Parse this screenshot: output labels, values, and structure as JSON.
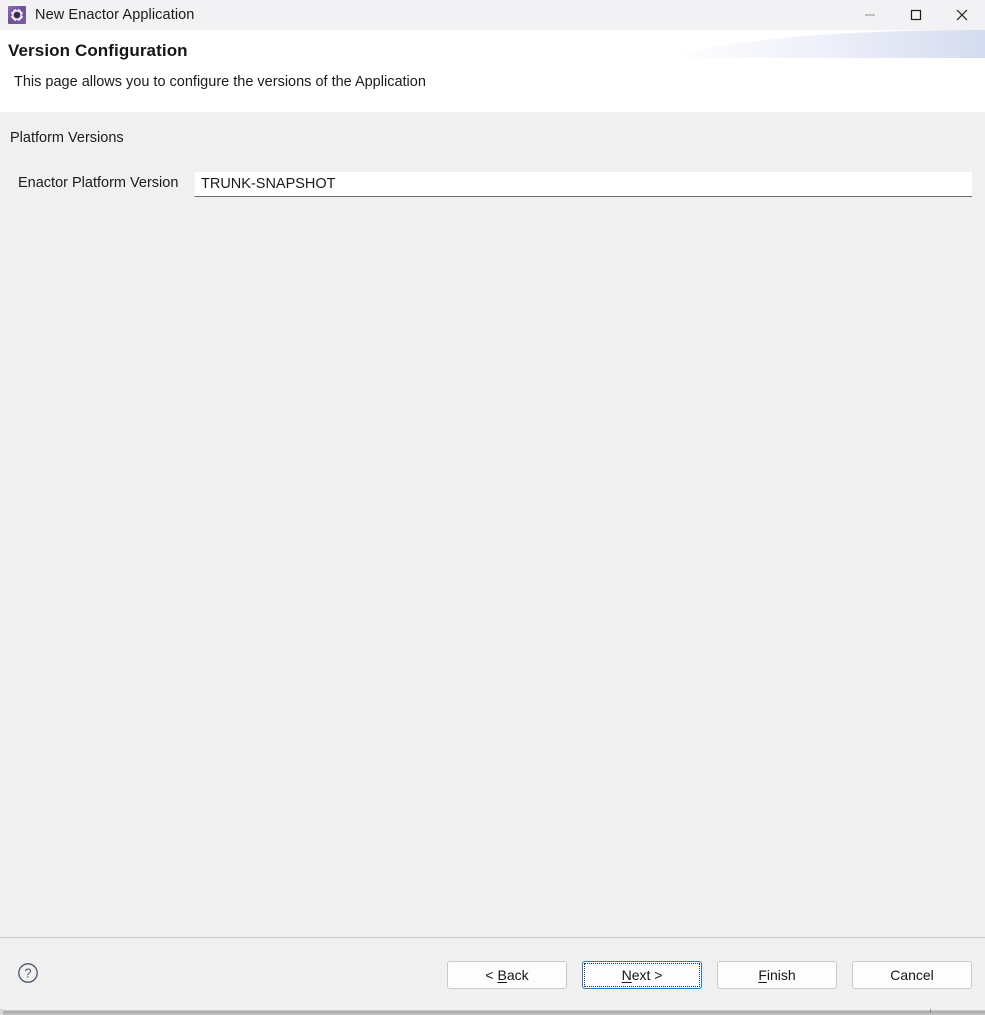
{
  "window": {
    "title": "New Enactor Application",
    "icon": "gear-icon",
    "controls": {
      "minimize": "minimize-icon",
      "maximize": "maximize-icon",
      "close": "close-icon"
    }
  },
  "header": {
    "title": "Version Configuration",
    "description": "This page allows you to configure the versions of the Application"
  },
  "main": {
    "group_label": "Platform Versions",
    "fields": [
      {
        "label": "Enactor Platform Version",
        "value": "TRUNK-SNAPSHOT",
        "placeholder": ""
      }
    ]
  },
  "footer": {
    "help_icon": "help-circle-icon",
    "buttons": [
      {
        "name": "back",
        "label": "< Back",
        "mnemonic": "B",
        "focused": false
      },
      {
        "name": "next",
        "label": "Next >",
        "mnemonic": "N",
        "focused": true
      },
      {
        "name": "finish",
        "label": "Finish",
        "mnemonic": "F",
        "focused": false
      },
      {
        "name": "cancel",
        "label": "Cancel",
        "mnemonic": "",
        "focused": false
      }
    ]
  },
  "colors": {
    "titlebar_bg": "#f2f2f4",
    "header_bg": "#ffffff",
    "body_bg": "#f0f0f0",
    "separator": "#c8c8c8",
    "focus_border": "#2a7ac0",
    "icon_purple": "#6f4f96",
    "help_icon": "#46566b",
    "wave_blue": "#dfe4f3"
  },
  "button_parts": {
    "back": {
      "pre": "< ",
      "mn": "B",
      "post": "ack"
    },
    "next": {
      "pre": "",
      "mn": "N",
      "post": "ext >"
    },
    "finish": {
      "pre": "",
      "mn": "F",
      "post": "inish"
    },
    "cancel": {
      "pre": "",
      "mn": "",
      "post": "Cancel"
    }
  }
}
